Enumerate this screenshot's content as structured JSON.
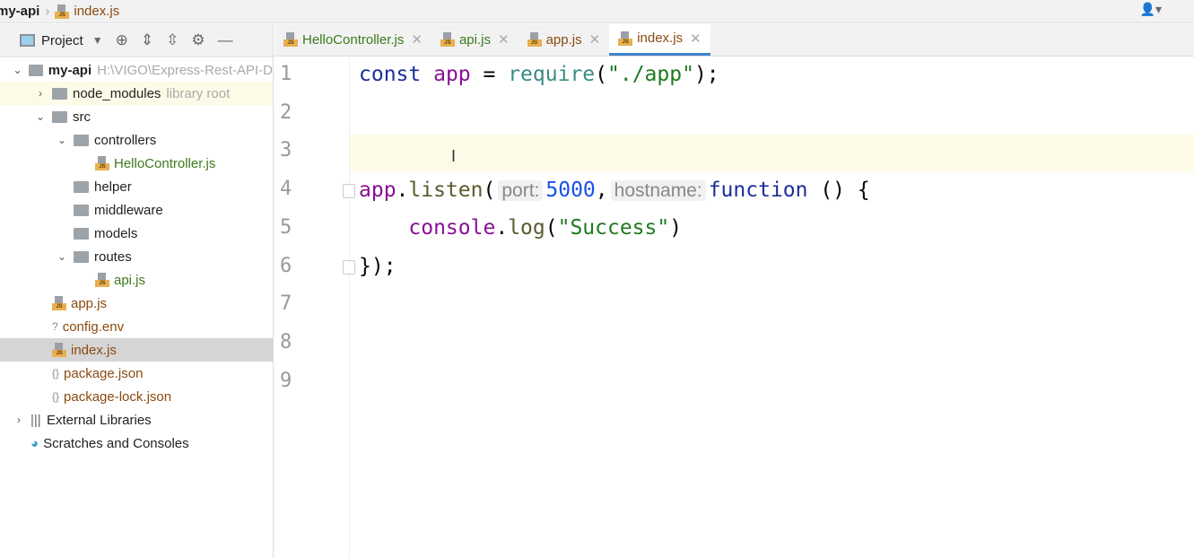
{
  "breadcrumb": {
    "root": "my-api",
    "file": "index.js"
  },
  "sidebar": {
    "title": "Project",
    "tree": [
      {
        "label": "my-api",
        "hint": "H:\\VIGO\\Express-Rest-API-D",
        "level": 0,
        "type": "folder",
        "arrow": "down",
        "bold": true
      },
      {
        "label": "node_modules",
        "hint": "library root",
        "level": 1,
        "type": "folder",
        "arrow": "right",
        "hl": true
      },
      {
        "label": "src",
        "level": 1,
        "type": "folder",
        "arrow": "down"
      },
      {
        "label": "controllers",
        "level": 2,
        "type": "folder",
        "arrow": "down"
      },
      {
        "label": "HelloController.js",
        "level": 3,
        "type": "js",
        "color": "green"
      },
      {
        "label": "helper",
        "level": 2,
        "type": "folder"
      },
      {
        "label": "middleware",
        "level": 2,
        "type": "folder"
      },
      {
        "label": "models",
        "level": 2,
        "type": "folder"
      },
      {
        "label": "routes",
        "level": 2,
        "type": "folder",
        "arrow": "down"
      },
      {
        "label": "api.js",
        "level": 3,
        "type": "js",
        "color": "green"
      },
      {
        "label": "app.js",
        "level": 1,
        "type": "js",
        "color": "brown"
      },
      {
        "label": "config.env",
        "level": 1,
        "type": "env",
        "color": "brown"
      },
      {
        "label": "index.js",
        "level": 1,
        "type": "js",
        "color": "brown",
        "selected": true
      },
      {
        "label": "package.json",
        "level": 1,
        "type": "json",
        "color": "brown"
      },
      {
        "label": "package-lock.json",
        "level": 1,
        "type": "json",
        "color": "brown"
      },
      {
        "label": "External Libraries",
        "level": 0,
        "type": "lib",
        "arrow": "right"
      },
      {
        "label": "Scratches and Consoles",
        "level": 0,
        "type": "scratch"
      }
    ]
  },
  "tabs": [
    {
      "label": "HelloController.js",
      "color": "green"
    },
    {
      "label": "api.js",
      "color": "green"
    },
    {
      "label": "app.js",
      "color": "brown"
    },
    {
      "label": "index.js",
      "color": "brown",
      "active": true
    }
  ],
  "editor": {
    "line_numbers": [
      "1",
      "2",
      "3",
      "4",
      "5",
      "6",
      "7",
      "8",
      "9"
    ],
    "line1": {
      "kw": "const",
      "var": "app",
      "eq": " = ",
      "fn": "require",
      "p1": "(",
      "str": "\"./app\"",
      "p2": ");"
    },
    "line4": {
      "var": "app",
      "dot": ".",
      "mth": "listen",
      "p1": "(",
      "hint1": "port:",
      "num": "5000",
      "comma": ",",
      "hint2": "hostname:",
      "kw": "function",
      "rest": " () {"
    },
    "line5": {
      "indent": "    ",
      "var": "console",
      "dot": ".",
      "mth": "log",
      "p1": "(",
      "str": "\"Success\"",
      "p2": ")"
    },
    "line6": {
      "text": "});"
    }
  }
}
